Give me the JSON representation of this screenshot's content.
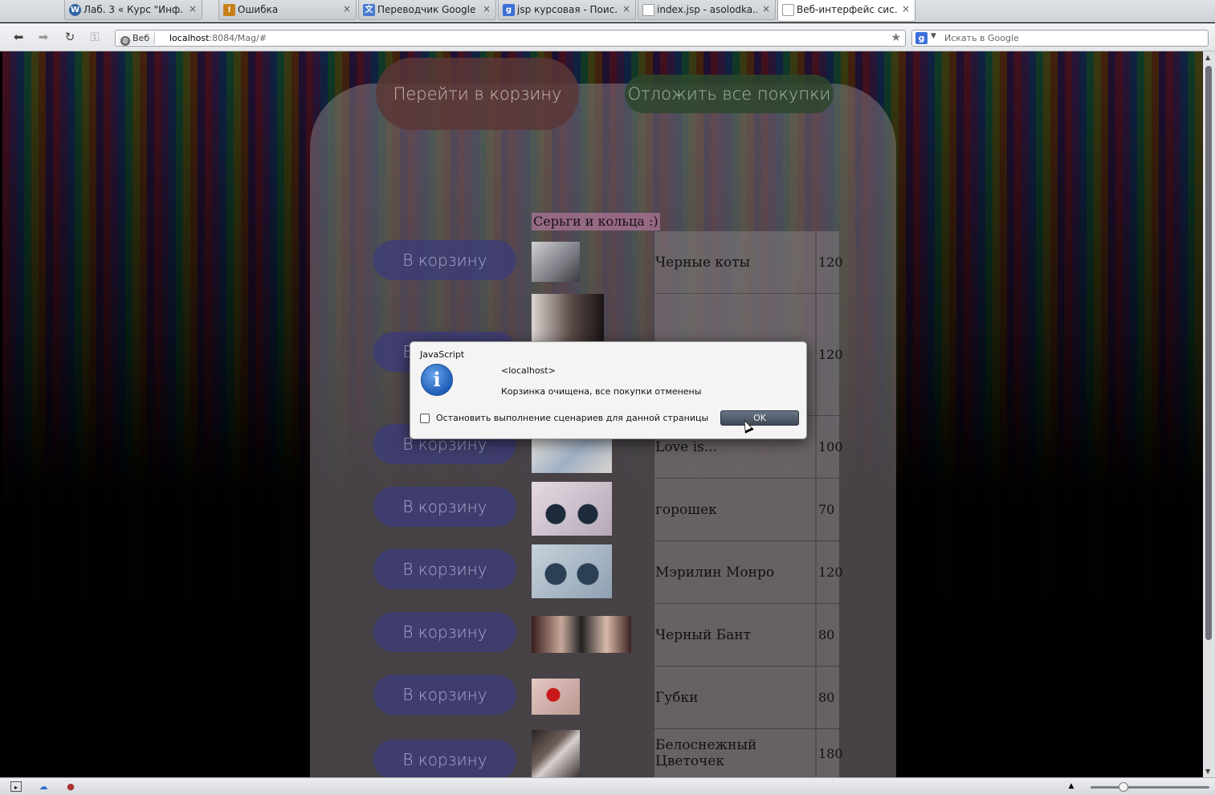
{
  "tabs": [
    {
      "label": "Лаб. 3 « Курс \"Инф...",
      "fav": "W",
      "favcolor": "#3465a4",
      "close": "×"
    },
    {
      "label": "Ошибка",
      "fav": "!",
      "favcolor": "#c8801a",
      "close": "×"
    },
    {
      "label": "Переводчик Google",
      "fav": "文",
      "favcolor": "#4a7bd0",
      "close": "×"
    },
    {
      "label": "jsp курсовая - Поис...",
      "fav": "g",
      "favcolor": "#3b6fd8",
      "close": "×"
    },
    {
      "label": "index.jsp - asolodka...",
      "fav": "",
      "favcolor": "#ffffff",
      "close": "×"
    },
    {
      "label": "Веб-интерфейс сис...",
      "fav": "",
      "favcolor": "#ffffff",
      "close": "×"
    }
  ],
  "nav": {
    "back": "⬅",
    "forward": "➡",
    "reload": "↻",
    "key": "⚿",
    "web_label": "Веб",
    "url_host": "localhost",
    "url_rest": ":8084/Mag/#",
    "star": "★",
    "search_engine": "g",
    "search_placeholder": "Искать в Google"
  },
  "page": {
    "cart_button": "Перейти в корзину",
    "defer_button": "Отложить все покупки",
    "section_title": "Серьги и кольца :)",
    "add_button": "В корзину",
    "items": [
      {
        "name": "Черные коты",
        "price": "120"
      },
      {
        "name": "",
        "price": "120"
      },
      {
        "name": "Love is...",
        "price": "100"
      },
      {
        "name": "горошек",
        "price": "70"
      },
      {
        "name": "Мэрилин Монро",
        "price": "120"
      },
      {
        "name": "Черный Бант",
        "price": "80"
      },
      {
        "name": "Губки",
        "price": "80"
      },
      {
        "name": "Белоснежный Цветочек",
        "price": "180"
      }
    ]
  },
  "dialog": {
    "title": "JavaScript",
    "icon": "i",
    "host": "<localhost>",
    "message": "Корзинка очищена, все покупки отменены",
    "checkbox_label": "Остановить выполнение сценариев для данной страницы",
    "ok": "OK"
  }
}
